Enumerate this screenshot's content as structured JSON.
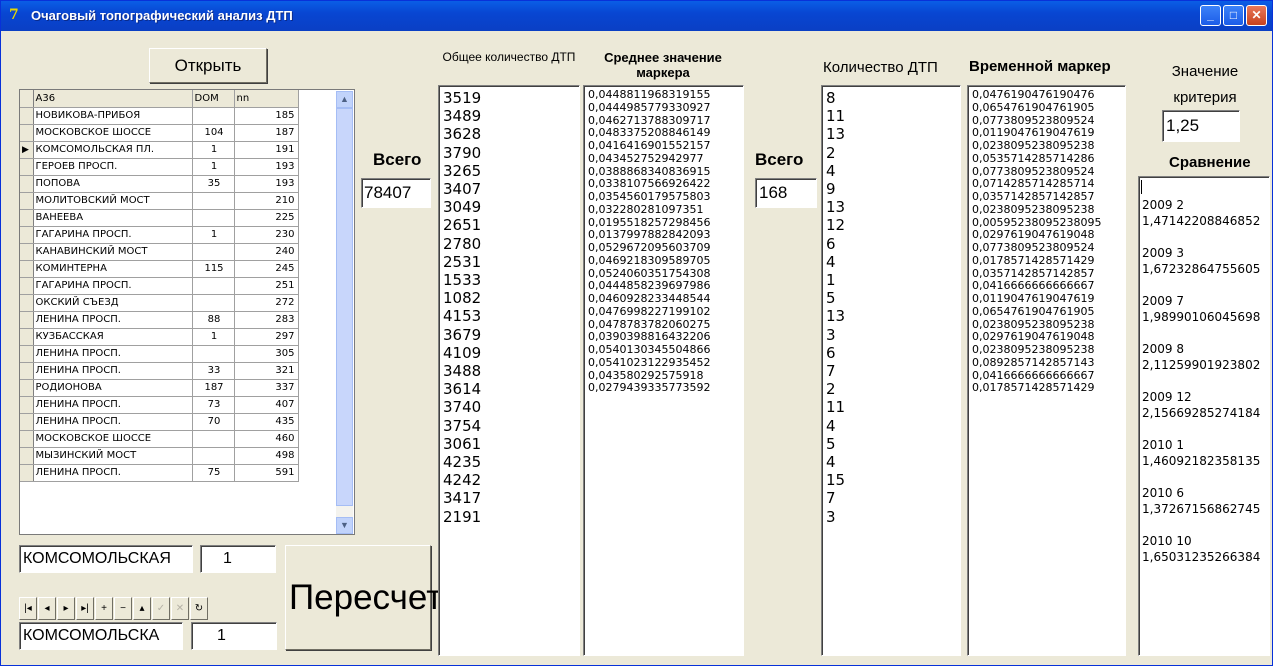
{
  "window": {
    "title": "Очаговый топографический анализ ДТП",
    "min_icon": "minimize-icon",
    "max_icon": "maximize-icon",
    "close_icon": "close-icon"
  },
  "open_button": "Открыть",
  "grid": {
    "headers": [
      "А36",
      "DOM",
      "nn"
    ],
    "current_row": 2,
    "rows": [
      [
        "НОВИКОВА-ПРИБОЯ",
        "",
        "185"
      ],
      [
        "МОСКОВСКОЕ ШОССЕ",
        "104",
        "187"
      ],
      [
        "КОМСОМОЛЬСКАЯ ПЛ.",
        "1",
        "191"
      ],
      [
        "ГЕРОЕВ ПРОСП.",
        "1",
        "193"
      ],
      [
        "ПОПОВА",
        "35",
        "193"
      ],
      [
        "МОЛИТОВСКИЙ МОСТ",
        "",
        "210"
      ],
      [
        "ВАНЕЕВА",
        "",
        "225"
      ],
      [
        "ГАГАРИНА ПРОСП.",
        "1",
        "230"
      ],
      [
        "КАНАВИНСКИЙ МОСТ",
        "",
        "240"
      ],
      [
        "КОМИНТЕРНА",
        "115",
        "245"
      ],
      [
        "ГАГАРИНА ПРОСП.",
        "",
        "251"
      ],
      [
        "ОКСКИЙ СЪЕЗД",
        "",
        "272"
      ],
      [
        "ЛЕНИНА ПРОСП.",
        "88",
        "283"
      ],
      [
        "КУЗБАССКАЯ",
        "1",
        "297"
      ],
      [
        "ЛЕНИНА ПРОСП.",
        "",
        "305"
      ],
      [
        "ЛЕНИНА ПРОСП.",
        "33",
        "321"
      ],
      [
        "РОДИОНОВА",
        "187",
        "337"
      ],
      [
        "ЛЕНИНА ПРОСП.",
        "73",
        "407"
      ],
      [
        "ЛЕНИНА ПРОСП.",
        "70",
        "435"
      ],
      [
        "МОСКОВСКОЕ ШОССЕ",
        "",
        "460"
      ],
      [
        "МЫЗИНСКИЙ МОСТ",
        "",
        "498"
      ],
      [
        "ЛЕНИНА ПРОСП.",
        "75",
        "591"
      ]
    ]
  },
  "street_field_1": "КОМСОМОЛЬСКАЯ",
  "house_field_1": "1",
  "street_field_2": "КОМСОМОЛЬСКА",
  "house_field_2": "1",
  "navigator": [
    {
      "name": "nav-first-icon",
      "glyph": "|◂",
      "enabled": true
    },
    {
      "name": "nav-prior-icon",
      "glyph": "◂",
      "enabled": true
    },
    {
      "name": "nav-next-icon",
      "glyph": "▸",
      "enabled": true
    },
    {
      "name": "nav-last-icon",
      "glyph": "▸|",
      "enabled": true
    },
    {
      "name": "nav-insert-icon",
      "glyph": "+",
      "enabled": true
    },
    {
      "name": "nav-delete-icon",
      "glyph": "−",
      "enabled": true
    },
    {
      "name": "nav-edit-icon",
      "glyph": "▴",
      "enabled": true
    },
    {
      "name": "nav-post-icon",
      "glyph": "✓",
      "enabled": false
    },
    {
      "name": "nav-cancel-icon",
      "glyph": "✕",
      "enabled": false
    },
    {
      "name": "nav-refresh-icon",
      "glyph": "↻",
      "enabled": true
    }
  ],
  "recalc_button": "Пересчет",
  "total_label_1": "Всего",
  "total_value_1": "78407",
  "total_label_2": "Всего",
  "total_value_2": "168",
  "col_total_header": "Общее количество ДТП",
  "col_marker_header": "Среднее значение маркера",
  "col_count_header": "Количество ДТП",
  "col_time_header": "Временной маркер",
  "criterion_label": "Значение критерия",
  "criterion_value": "1,25",
  "compare_label": "Сравнение",
  "total_counts": "3519\n3489\n3628\n3790\n3265\n3407\n3049\n2651\n2780\n2531\n1533\n1082\n4153\n3679\n4109\n3488\n3614\n3740\n3754\n3061\n4235\n4242\n3417\n2191",
  "marker_values": "0,0448811968319155\n0,0444985779330927\n0,0462713788309717\n0,0483375208846149\n0,0416416901552157\n0,043452752942977\n0,0388868340836915\n0,0338107566926422\n0,0354560179575803\n0,032280281097351\n0,0195518257298456\n0,0137997882842093\n0,0529672095603709\n0,0469218309589705\n0,0524060351754308\n0,0444858239697986\n0,0460928233448544\n0,0476998227199102\n0,0478783782060275\n0,0390398816432206\n0,0540130345504866\n0,0541023122935452\n0,043580292575918\n0,0279439335773592",
  "accident_counts": "8\n11\n13\n2\n4\n9\n13\n12\n6\n4\n1\n5\n13\n3\n6\n7\n2\n11\n4\n5\n4\n15\n7\n3",
  "time_markers": "0,0476190476190476\n0,0654761904761905\n0,0773809523809524\n0,0119047619047619\n0,0238095238095238\n0,0535714285714286\n0,0773809523809524\n0,0714285714285714\n0,0357142857142857\n0,0238095238095238\n0,00595238095238095\n0,0297619047619048\n0,0773809523809524\n0,0178571428571429\n0,0357142857142857\n0,0416666666666667\n0,0119047619047619\n0,0654761904761905\n0,0238095238095238\n0,0297619047619048\n0,0238095238095238\n0,0892857142857143\n0,0416666666666667\n0,0178571428571429",
  "comparison": [
    [
      "2009 2",
      "1,47142208846852"
    ],
    [
      "2009 3",
      "1,67232864755605"
    ],
    [
      "2009 7",
      "1,98990106045698"
    ],
    [
      "2009 8",
      "2,11259901923802"
    ],
    [
      "2009 12",
      "2,15669285274184"
    ],
    [
      "2010 1",
      "1,46092182358135"
    ],
    [
      "2010 6",
      "1,37267156862745"
    ],
    [
      "2010 10",
      "1,65031235266384"
    ]
  ]
}
